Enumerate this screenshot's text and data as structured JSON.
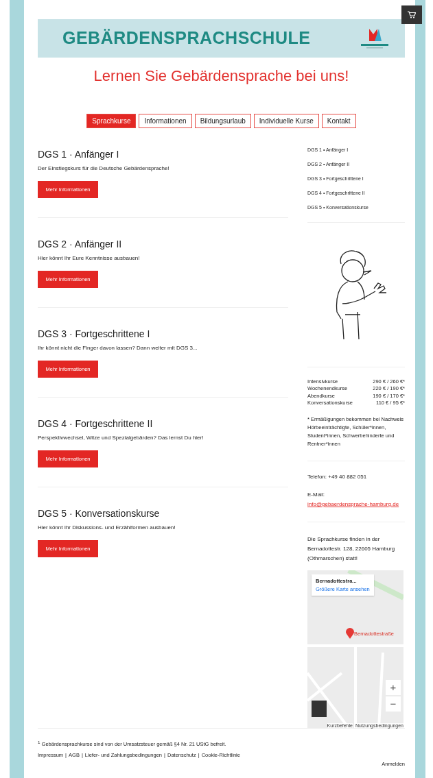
{
  "header": {
    "brand": "GEBÄRDENSPRACHSCHULE"
  },
  "headline": "Lernen Sie Gebärdensprache bei uns!",
  "nav": [
    {
      "label": "Sprachkurse",
      "selected": true
    },
    {
      "label": "Informationen",
      "selected": false
    },
    {
      "label": "Bildungsurlaub",
      "selected": false
    },
    {
      "label": "Individuelle Kurse",
      "selected": false
    },
    {
      "label": "Kontakt",
      "selected": false
    }
  ],
  "courses": [
    {
      "title": "DGS 1 · Anfänger I",
      "description": "Der Einstiegskurs für die Deutsche Gebärdensprache!",
      "button": "Mehr Informationen"
    },
    {
      "title": "DGS 2 · Anfänger II",
      "description": "Hier könnt Ihr Eure Kenntnisse ausbauen!",
      "button": "Mehr Informationen"
    },
    {
      "title": "DGS 3 · Fortgeschrittene I",
      "description": "Ihr könnt nicht die Finger davon lassen? Dann weiter mit DGS 3...",
      "button": "Mehr Informationen"
    },
    {
      "title": "DGS 4 · Fortgeschrittene II",
      "description": "Perspektivwechsel, Witze und Spezialgebärden? Das lernst Du hier!",
      "button": "Mehr Informationen"
    },
    {
      "title": "DGS 5 · Konversationskurse",
      "description": "Hier könnt Ihr Diskussions- und Erzählformen ausbauen!",
      "button": "Mehr Informationen"
    }
  ],
  "sidebar": {
    "course_links": [
      "DGS 1 • Anfänger I",
      "DGS 2 • Anfänger II",
      "DGS 3 • Fortgeschrittene I",
      "DGS 4 • Fortgeschrittene II",
      "DGS 5 • Konversationskurse"
    ],
    "prices": [
      {
        "name": "Intensivkurse",
        "price": "290 € / 260 €*"
      },
      {
        "name": "Wochenendkurse",
        "price": "220 € / 190 €*"
      },
      {
        "name": "Abendkurse",
        "price": "190 € / 170 €*"
      },
      {
        "name": "Konversationskurse",
        "price": "110 € / 95 €*"
      }
    ],
    "price_note": "* Ermäßigungen bekommen bei Nachweis Hörbeeinträchtigte, Schüler*innen, Student*innen, Schwerbehinderte und Rentner*innen",
    "phone": "Telefon: +49 40 882 051",
    "email_label": "E-Mail:",
    "email": "info@gebaerdensprache-hamburg.de",
    "location": "Die Sprachkurse finden in der Bernadottestr. 128, 22605 Hamburg (Othmarschen) statt!",
    "map": {
      "place_title": "Bernadottestra...",
      "larger_map": "Größere Karte ansehen",
      "marker_label": "Bernadottestraße",
      "zoom_in": "+",
      "zoom_out": "−",
      "attribution": [
        "Kurzbefehle",
        "Nutzungsbedingungen"
      ]
    }
  },
  "footer": {
    "note": "$^{1}$ Gebärdensprachkurse sind von der Umsatzsteuer gemäß §4 Nr. 21 UStG befreit.",
    "separator": "|",
    "links": [
      "Impressum",
      "AGB",
      "Liefer- und Zahlungsbedingungen",
      "Datenschutz",
      "Cookie-Richtlinie"
    ],
    "login": "Anmelden"
  }
}
